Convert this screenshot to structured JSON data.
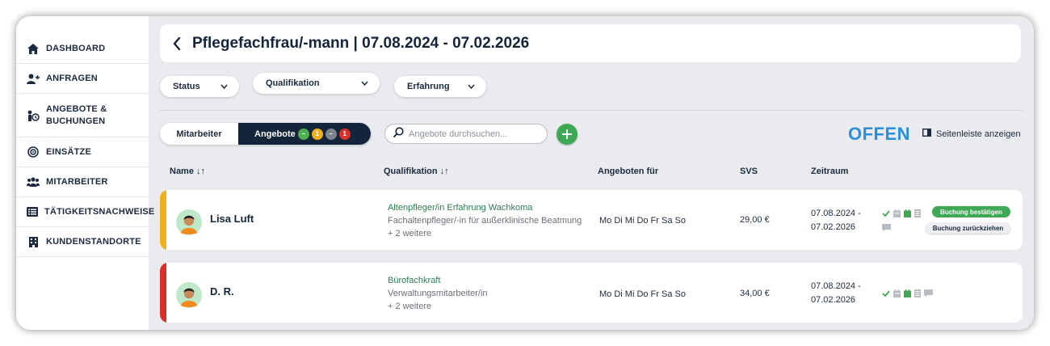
{
  "sidebar": {
    "items": [
      {
        "label": "DASHBOARD",
        "icon": "home-icon"
      },
      {
        "label": "ANFRAGEN",
        "icon": "user-plus-icon"
      },
      {
        "label": "ANGEBOTE &",
        "label2": "BUCHUNGEN",
        "icon": "offer-icon"
      },
      {
        "label": "EINSÄTZE",
        "icon": "target-icon"
      },
      {
        "label": "MITARBEITER",
        "icon": "users-icon"
      },
      {
        "label": "TÄTIGKEITSNACHWEISE",
        "icon": "list-icon"
      },
      {
        "label": "KUNDENSTANDORTE",
        "icon": "building-icon"
      }
    ]
  },
  "header": {
    "title": "Pflegefachfrau/-mann | 07.08.2024 - 07.02.2026"
  },
  "filters": [
    {
      "label": "Status"
    },
    {
      "label": "Qualifikation"
    },
    {
      "label": "Erfahrung"
    }
  ],
  "toggle": {
    "left": "Mitarbeiter",
    "right": "Angebote",
    "badges": [
      {
        "text": "–",
        "color": "#4caf50"
      },
      {
        "text": "1",
        "color": "#f2b01e"
      },
      {
        "text": "–",
        "color": "#7d848c"
      },
      {
        "text": "1",
        "color": "#d9302c"
      }
    ]
  },
  "search": {
    "placeholder": "Angebote durchsuchen..."
  },
  "status": {
    "label": "OFFEN",
    "color": "#2a8fd8"
  },
  "sidebar_toggle": {
    "label": "Seitenleiste anzeigen"
  },
  "columns": {
    "name": "Name ↓↑",
    "qualifikation": "Qualifikation ↓↑",
    "angeboten": "Angeboten für",
    "svs": "SVS",
    "zeitraum": "Zeitraum"
  },
  "rows": [
    {
      "name": "Lisa Luft",
      "bar_color": "#f2b01e",
      "qual_primary": "Altenpfleger/in Erfahrung Wachkoma",
      "qual_secondary": "Fachaltenpfleger/-in für außerklinische Beatmung",
      "qual_more": "+ 2 weitere",
      "days": "Mo Di Mi Do Fr Sa So",
      "svs": "29,00 €",
      "zeit_from": "07.08.2024 -",
      "zeit_to": "07.02.2026",
      "btn_confirm": "Buchung bestätigen",
      "btn_back": "Buchung zurückziehen"
    },
    {
      "name": "D. R.",
      "bar_color": "#d9302c",
      "qual_primary": "Bürofachkraft",
      "qual_secondary": "Verwaltungsmitarbeiter/in",
      "qual_more": "+ 2 weitere",
      "days": "Mo Di Mi Do Fr Sa So",
      "svs": "34,00 €",
      "zeit_from": "07.08.2024 -",
      "zeit_to": "07.02.2026"
    }
  ]
}
